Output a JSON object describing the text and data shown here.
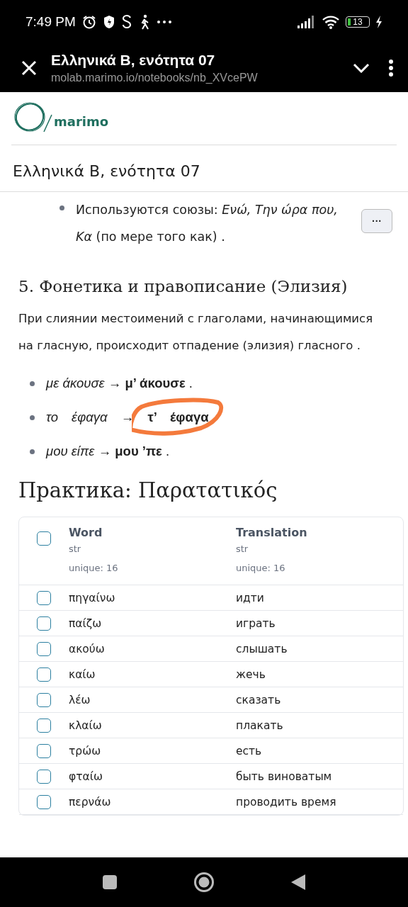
{
  "status_bar": {
    "time": "7:49 PM",
    "battery": "13"
  },
  "browser": {
    "title": "Ελληνικά Β, ενότητα 07",
    "url": "molab.marimo.io/notebooks/nb_XVcePW"
  },
  "app": {
    "logo": "marimo",
    "notebook_title": "Ελληνικά Β, ενότητα 07"
  },
  "content": {
    "top_bullets": [
      {
        "text": "Используются союзы: *Ενώ, Την ώρα  που, Κα* (по мере того как) ."
      }
    ],
    "more_button": "···",
    "section_heading": "5. Фонетика и правописание (Элизия)",
    "paragraph": "При слиянии местоимений с глаголами, начинающимися на гласную, происходит отпадение (элизия) гласного .",
    "examples": [
      {
        "text": "*με άκουσε* → **μ’ άκουσε** .",
        "circled": false
      },
      {
        "text": "*το έφαγα* → **τ’ έφαγα**",
        "circled": true
      },
      {
        "text": "*μου είπε* → **μου ’πε** ."
      }
    ],
    "practice_heading": "Практика: Παρατατικός"
  },
  "table": {
    "header_checked": false,
    "columns": [
      {
        "name": "Word",
        "type": "str",
        "stats": "unique: 16"
      },
      {
        "name": "Translation",
        "type": "str",
        "stats": "unique: 16"
      }
    ],
    "rows": [
      {
        "cells": [
          "πηγαίνω",
          "идти"
        ],
        "checked": false
      },
      {
        "cells": [
          "παίζω",
          "играть"
        ],
        "checked": false
      },
      {
        "cells": [
          "ακούω",
          "слышать"
        ],
        "checked": false
      },
      {
        "cells": [
          "καίω",
          "жечь"
        ],
        "checked": false
      },
      {
        "cells": [
          "λέω",
          "сказать"
        ],
        "checked": false
      },
      {
        "cells": [
          "κλαίω",
          "плакать"
        ],
        "checked": false
      },
      {
        "cells": [
          "τρώω",
          "есть"
        ],
        "checked": false
      },
      {
        "cells": [
          "φταίω",
          "быть виноватым"
        ],
        "checked": false
      },
      {
        "cells": [
          "περνάω",
          "проводить время"
        ],
        "checked": false
      }
    ]
  }
}
